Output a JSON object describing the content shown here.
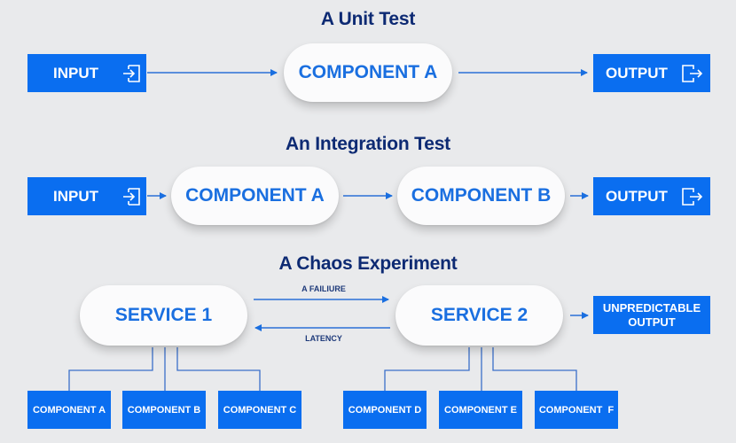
{
  "unit_test": {
    "title": "A Unit Test",
    "input": {
      "label": "INPUT",
      "icon": "login-icon"
    },
    "component": "COMPONENT A",
    "output": {
      "label": "OUTPUT",
      "icon": "logout-icon"
    }
  },
  "integration_test": {
    "title": "An Integration Test",
    "input": {
      "label": "INPUT",
      "icon": "login-icon"
    },
    "components": [
      "COMPONENT A",
      "COMPONENT B"
    ],
    "output": {
      "label": "OUTPUT",
      "icon": "logout-icon"
    }
  },
  "chaos_experiment": {
    "title": "A Chaos Experiment",
    "service_1": "SERVICE 1",
    "service_2": "SERVICE 2",
    "arrow_forward_label": "A FAILIURE",
    "arrow_back_label": "LATENCY",
    "output": {
      "line1": "UNPREDICTABLE",
      "line2": "OUTPUT"
    },
    "service_1_components": [
      "COMPONENT A",
      "COMPONENT B",
      "COMPONENT C"
    ],
    "service_2_components": [
      "COMPONENT D",
      "COMPONENT E",
      "COMPONENT  F"
    ]
  },
  "colors": {
    "background": "#e9eaec",
    "box_blue": "#0a6ef0",
    "title_navy": "#0d2a73",
    "pill_text_blue": "#1a6fe0",
    "line_blue": "#2b6fd6"
  }
}
